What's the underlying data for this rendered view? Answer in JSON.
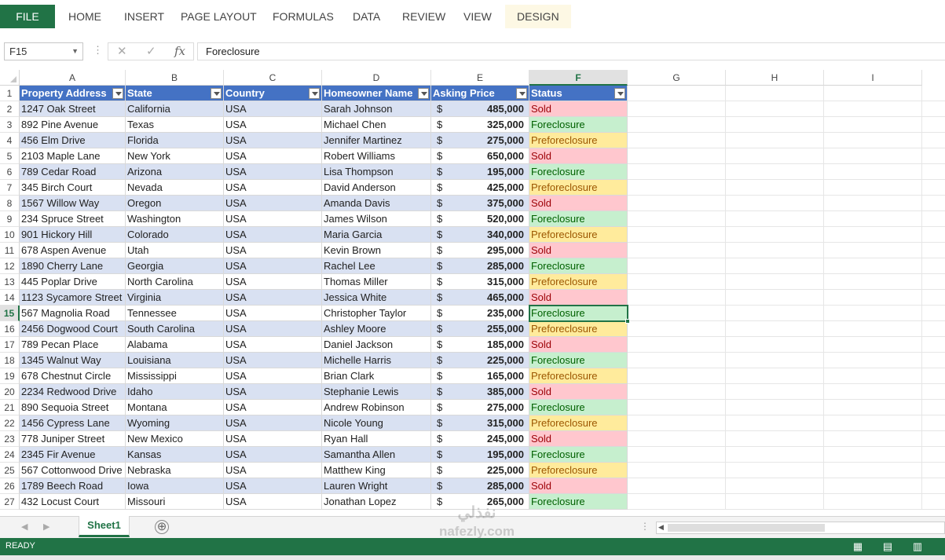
{
  "ribbon": {
    "file_label": "FILE",
    "tabs": [
      "HOME",
      "INSERT",
      "PAGE LAYOUT",
      "FORMULAS",
      "DATA",
      "REVIEW",
      "VIEW",
      "DESIGN"
    ]
  },
  "formula_bar": {
    "name_box": "F15",
    "dots": "⋮",
    "cancel_icon": "✕",
    "enter_icon": "✓",
    "fx_icon": "fx",
    "content": "Foreclosure"
  },
  "columns": [
    "A",
    "B",
    "C",
    "D",
    "E",
    "F",
    "G",
    "H",
    "I"
  ],
  "selected_column": "F",
  "selected_row": 15,
  "table": {
    "headers": [
      "Property Address",
      "State",
      "Country",
      "Homeowner Name",
      "Asking Price",
      "Status"
    ],
    "currency_symbol": "$",
    "rows": [
      {
        "n": "2",
        "address": "1247 Oak Street",
        "state": "California",
        "country": "USA",
        "owner": "Sarah Johnson",
        "price": "485,000",
        "status": "Sold"
      },
      {
        "n": "3",
        "address": "892 Pine Avenue",
        "state": "Texas",
        "country": "USA",
        "owner": "Michael Chen",
        "price": "325,000",
        "status": "Foreclosure"
      },
      {
        "n": "4",
        "address": "456 Elm Drive",
        "state": "Florida",
        "country": "USA",
        "owner": "Jennifer Martinez",
        "price": "275,000",
        "status": "Preforeclosure"
      },
      {
        "n": "5",
        "address": "2103 Maple Lane",
        "state": "New York",
        "country": "USA",
        "owner": "Robert Williams",
        "price": "650,000",
        "status": "Sold"
      },
      {
        "n": "6",
        "address": "789 Cedar Road",
        "state": "Arizona",
        "country": "USA",
        "owner": "Lisa Thompson",
        "price": "195,000",
        "status": "Foreclosure"
      },
      {
        "n": "7",
        "address": "345 Birch Court",
        "state": "Nevada",
        "country": "USA",
        "owner": "David Anderson",
        "price": "425,000",
        "status": "Preforeclosure"
      },
      {
        "n": "8",
        "address": "1567 Willow Way",
        "state": "Oregon",
        "country": "USA",
        "owner": "Amanda Davis",
        "price": "375,000",
        "status": "Sold"
      },
      {
        "n": "9",
        "address": "234 Spruce Street",
        "state": "Washington",
        "country": "USA",
        "owner": "James Wilson",
        "price": "520,000",
        "status": "Foreclosure"
      },
      {
        "n": "10",
        "address": "901 Hickory Hill",
        "state": "Colorado",
        "country": "USA",
        "owner": "Maria Garcia",
        "price": "340,000",
        "status": "Preforeclosure"
      },
      {
        "n": "11",
        "address": "678 Aspen Avenue",
        "state": "Utah",
        "country": "USA",
        "owner": "Kevin Brown",
        "price": "295,000",
        "status": "Sold"
      },
      {
        "n": "12",
        "address": "1890 Cherry Lane",
        "state": "Georgia",
        "country": "USA",
        "owner": "Rachel Lee",
        "price": "285,000",
        "status": "Foreclosure"
      },
      {
        "n": "13",
        "address": "445 Poplar Drive",
        "state": "North Carolina",
        "country": "USA",
        "owner": "Thomas Miller",
        "price": "315,000",
        "status": "Preforeclosure"
      },
      {
        "n": "14",
        "address": "1123 Sycamore Street",
        "state": "Virginia",
        "country": "USA",
        "owner": "Jessica White",
        "price": "465,000",
        "status": "Sold"
      },
      {
        "n": "15",
        "address": "567 Magnolia Road",
        "state": "Tennessee",
        "country": "USA",
        "owner": "Christopher Taylor",
        "price": "235,000",
        "status": "Foreclosure"
      },
      {
        "n": "16",
        "address": "2456 Dogwood Court",
        "state": "South Carolina",
        "country": "USA",
        "owner": "Ashley Moore",
        "price": "255,000",
        "status": "Preforeclosure"
      },
      {
        "n": "17",
        "address": "789 Pecan Place",
        "state": "Alabama",
        "country": "USA",
        "owner": "Daniel Jackson",
        "price": "185,000",
        "status": "Sold"
      },
      {
        "n": "18",
        "address": "1345 Walnut Way",
        "state": "Louisiana",
        "country": "USA",
        "owner": "Michelle Harris",
        "price": "225,000",
        "status": "Foreclosure"
      },
      {
        "n": "19",
        "address": "678 Chestnut Circle",
        "state": "Mississippi",
        "country": "USA",
        "owner": "Brian Clark",
        "price": "165,000",
        "status": "Preforeclosure"
      },
      {
        "n": "20",
        "address": "2234 Redwood Drive",
        "state": "Idaho",
        "country": "USA",
        "owner": "Stephanie Lewis",
        "price": "385,000",
        "status": "Sold"
      },
      {
        "n": "21",
        "address": "890 Sequoia Street",
        "state": "Montana",
        "country": "USA",
        "owner": "Andrew Robinson",
        "price": "275,000",
        "status": "Foreclosure"
      },
      {
        "n": "22",
        "address": "1456 Cypress Lane",
        "state": "Wyoming",
        "country": "USA",
        "owner": "Nicole Young",
        "price": "315,000",
        "status": "Preforeclosure"
      },
      {
        "n": "23",
        "address": "778 Juniper Street",
        "state": "New Mexico",
        "country": "USA",
        "owner": "Ryan Hall",
        "price": "245,000",
        "status": "Sold"
      },
      {
        "n": "24",
        "address": "2345 Fir Avenue",
        "state": "Kansas",
        "country": "USA",
        "owner": "Samantha Allen",
        "price": "195,000",
        "status": "Foreclosure"
      },
      {
        "n": "25",
        "address": "567 Cottonwood Drive",
        "state": "Nebraska",
        "country": "USA",
        "owner": "Matthew King",
        "price": "225,000",
        "status": "Preforeclosure"
      },
      {
        "n": "26",
        "address": "1789 Beech Road",
        "state": "Iowa",
        "country": "USA",
        "owner": "Lauren Wright",
        "price": "285,000",
        "status": "Sold"
      },
      {
        "n": "27",
        "address": "432 Locust Court",
        "state": "Missouri",
        "country": "USA",
        "owner": "Jonathan Lopez",
        "price": "265,000",
        "status": "Foreclosure"
      }
    ]
  },
  "status_colors": {
    "Sold": "#ffc7ce",
    "Foreclosure": "#c6efce",
    "Preforeclosure": "#ffeb9c"
  },
  "sheets": [
    "Sheet1"
  ],
  "add_sheet_icon": "⊕",
  "status_bar": {
    "text": "READY",
    "view_icons": [
      "normal-view-icon",
      "page-layout-view-icon",
      "page-break-view-icon"
    ]
  },
  "watermark": {
    "text": "نفذلي",
    "url": "nafezly.com"
  },
  "colors": {
    "accent": "#217346",
    "table_header": "#4472c4",
    "band": "#d9e1f2"
  }
}
